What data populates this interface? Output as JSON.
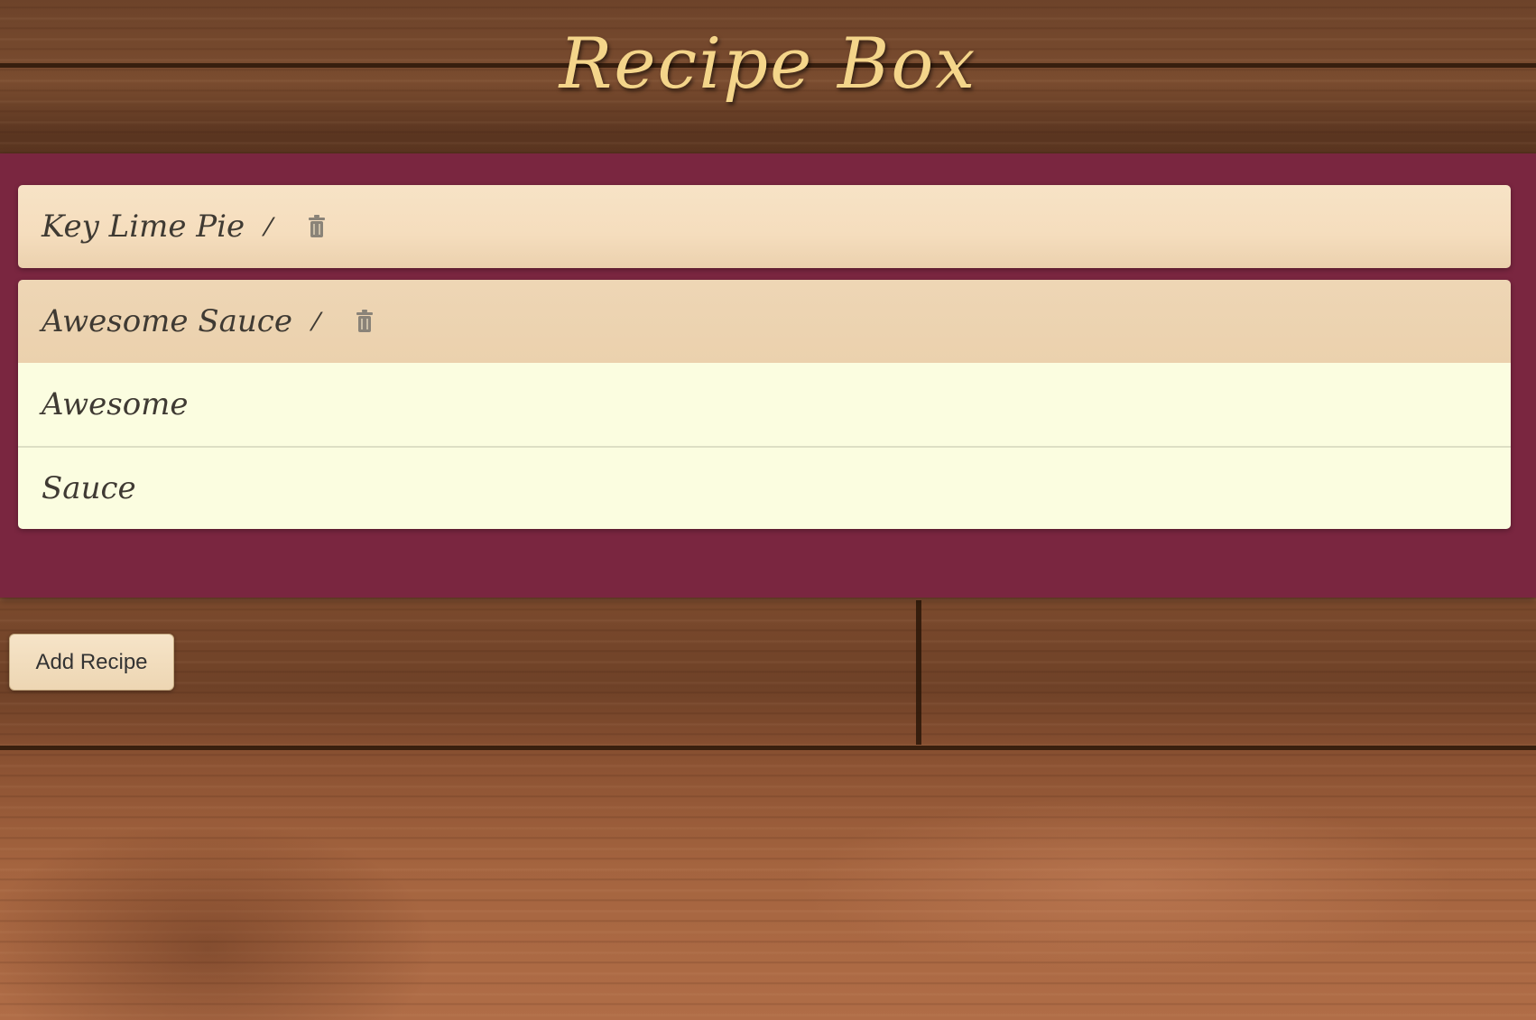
{
  "app": {
    "title": "Recipe Box"
  },
  "recipes": [
    {
      "name": "Key Lime Pie",
      "expanded": false,
      "ingredients": []
    },
    {
      "name": "Awesome Sauce",
      "expanded": true,
      "ingredients": [
        "Awesome",
        "Sauce"
      ]
    }
  ],
  "actions": {
    "add_recipe_label": "Add Recipe",
    "edit_icon": "pencil-icon",
    "delete_icon": "trash-icon"
  },
  "colors": {
    "panel": "#7a2640",
    "title": "#f4d58a",
    "heading": "#f5ddbd",
    "ingredient_bg": "#fbfde0"
  }
}
